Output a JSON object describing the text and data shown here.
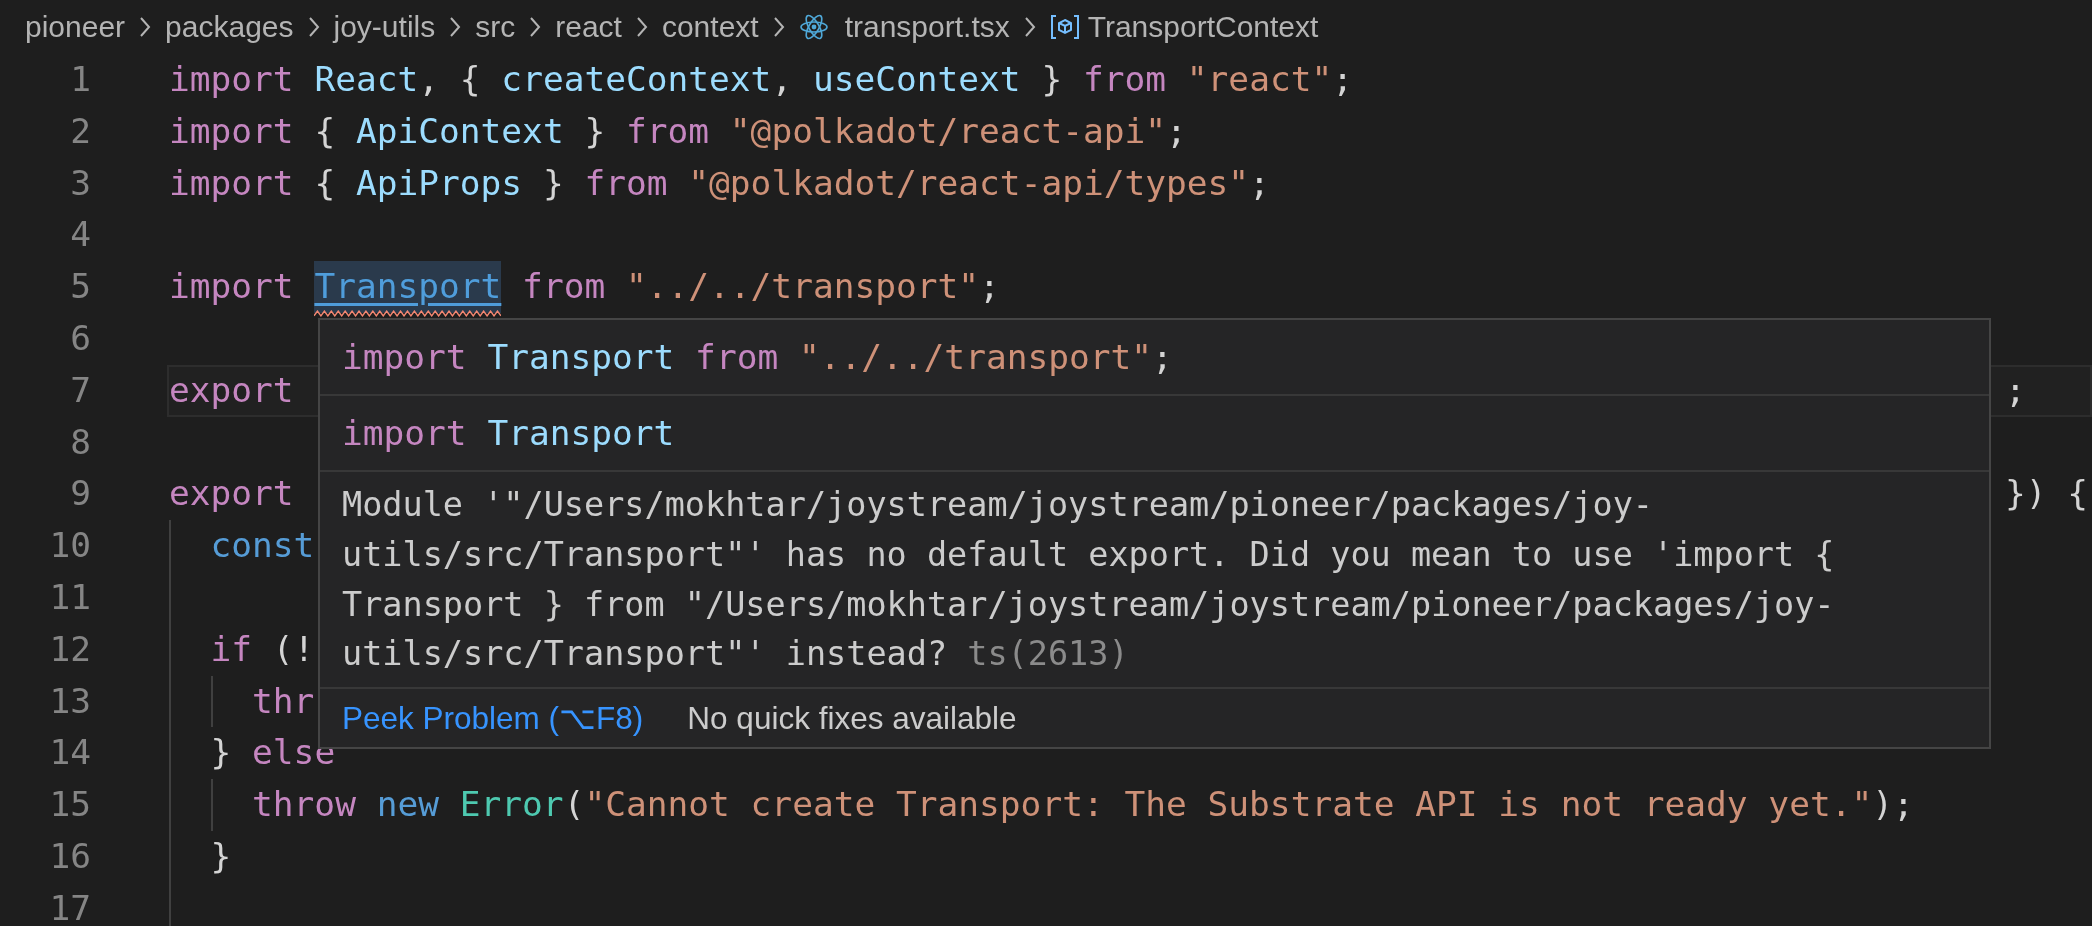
{
  "breadcrumb": [
    {
      "label": "pioneer",
      "kind": "folder"
    },
    {
      "label": "packages",
      "kind": "folder"
    },
    {
      "label": "joy-utils",
      "kind": "folder"
    },
    {
      "label": "src",
      "kind": "folder"
    },
    {
      "label": "react",
      "kind": "folder"
    },
    {
      "label": "context",
      "kind": "folder"
    },
    {
      "label": "transport.tsx",
      "kind": "react-file"
    },
    {
      "label": "TransportContext",
      "kind": "symbol"
    }
  ],
  "editor": {
    "lines": [
      {
        "number": "1",
        "current": false,
        "tokens": [
          {
            "kind": "keyword",
            "text": "import "
          },
          {
            "kind": "variable",
            "text": "React"
          },
          {
            "kind": "punct",
            "text": ", { "
          },
          {
            "kind": "variable",
            "text": "createContext"
          },
          {
            "kind": "punct",
            "text": ", "
          },
          {
            "kind": "variable",
            "text": "useContext"
          },
          {
            "kind": "punct",
            "text": " } "
          },
          {
            "kind": "keyword",
            "text": "from "
          },
          {
            "kind": "string",
            "text": "\"react\""
          },
          {
            "kind": "punct",
            "text": ";"
          }
        ]
      },
      {
        "number": "2",
        "current": false,
        "tokens": [
          {
            "kind": "keyword",
            "text": "import "
          },
          {
            "kind": "punct",
            "text": "{ "
          },
          {
            "kind": "variable",
            "text": "ApiContext"
          },
          {
            "kind": "punct",
            "text": " } "
          },
          {
            "kind": "keyword",
            "text": "from "
          },
          {
            "kind": "string",
            "text": "\"@polkadot/react-api\""
          },
          {
            "kind": "punct",
            "text": ";"
          }
        ]
      },
      {
        "number": "3",
        "current": false,
        "tokens": [
          {
            "kind": "keyword",
            "text": "import "
          },
          {
            "kind": "punct",
            "text": "{ "
          },
          {
            "kind": "variable",
            "text": "ApiProps"
          },
          {
            "kind": "punct",
            "text": " } "
          },
          {
            "kind": "keyword",
            "text": "from "
          },
          {
            "kind": "string",
            "text": "\"@polkadot/react-api/types\""
          },
          {
            "kind": "punct",
            "text": ";"
          }
        ]
      },
      {
        "number": "4",
        "current": false
      },
      {
        "number": "5",
        "current": false,
        "tokens": [
          {
            "kind": "keyword",
            "text": "import "
          },
          {
            "kind": "hovered-error",
            "text": "Transport"
          },
          {
            "kind": "keyword",
            "text": " from "
          },
          {
            "kind": "string",
            "text": "\"../../transport\""
          },
          {
            "kind": "punct",
            "text": ";"
          }
        ]
      },
      {
        "number": "6",
        "current": false
      },
      {
        "number": "7",
        "current": true,
        "tokens": [
          {
            "kind": "keyword",
            "text": "export"
          }
        ],
        "right_tokens": [
          {
            "kind": "punct",
            "text": ";"
          }
        ]
      },
      {
        "number": "8",
        "current": false
      },
      {
        "number": "9",
        "current": false,
        "tokens": [
          {
            "kind": "keyword",
            "text": "export"
          }
        ],
        "right_tokens": [
          {
            "kind": "punct",
            "text": "}) {"
          }
        ],
        "children": [
          {
            "number": "10",
            "current": false,
            "tokens": [
              {
                "kind": "storage",
                "text": "const"
              }
            ]
          },
          {
            "number": "11",
            "current": false
          },
          {
            "number": "12",
            "current": false,
            "tokens": [
              {
                "kind": "keyword",
                "text": "if"
              },
              {
                "kind": "punct",
                "text": " (!"
              }
            ],
            "children": [
              {
                "number": "13",
                "current": false,
                "tokens": [
                  {
                    "kind": "keyword",
                    "text": "thr"
                  }
                ]
              }
            ]
          },
          {
            "number": "14",
            "current": false,
            "tokens": [
              {
                "kind": "punct",
                "text": "} "
              },
              {
                "kind": "keyword",
                "text": "else"
              }
            ],
            "children": [
              {
                "number": "15",
                "current": false,
                "tokens": [
                  {
                    "kind": "keyword",
                    "text": "throw "
                  },
                  {
                    "kind": "storage",
                    "text": "new "
                  },
                  {
                    "kind": "type",
                    "text": "Error"
                  },
                  {
                    "kind": "punct",
                    "text": "("
                  },
                  {
                    "kind": "string",
                    "text": "\"Cannot create Transport: The Substrate API is not ready yet.\""
                  },
                  {
                    "kind": "punct",
                    "text": ");"
                  }
                ]
              }
            ]
          },
          {
            "number": "16",
            "current": false,
            "tokens": [
              {
                "kind": "punct",
                "text": "}"
              }
            ]
          },
          {
            "number": "17",
            "current": false
          }
        ]
      }
    ]
  },
  "hover": {
    "code_lines": [
      [
        {
          "kind": "keyword",
          "text": "import "
        },
        {
          "kind": "variable",
          "text": "Transport"
        },
        {
          "kind": "keyword",
          "text": " from "
        },
        {
          "kind": "string",
          "text": "\"../../transport\""
        },
        {
          "kind": "punct",
          "text": ";"
        }
      ],
      [
        {
          "kind": "keyword",
          "text": "import "
        },
        {
          "kind": "variable",
          "text": "Transport"
        }
      ]
    ],
    "message": {
      "text": "Module '\"/Users/mokhtar/joystream/joystream/pioneer/packages/joy-utils/src/Transport\"' has no default export. Did you mean to use 'import { Transport } from \"/Users/mokhtar/joystream/joystream/pioneer/packages/joy-utils/src/Transport\"' instead?",
      "code": "ts(2613)"
    },
    "actions": [
      {
        "label": "Peek Problem (⌥F8)",
        "kind": "link"
      },
      {
        "label": "No quick fixes available",
        "kind": "note"
      }
    ]
  }
}
